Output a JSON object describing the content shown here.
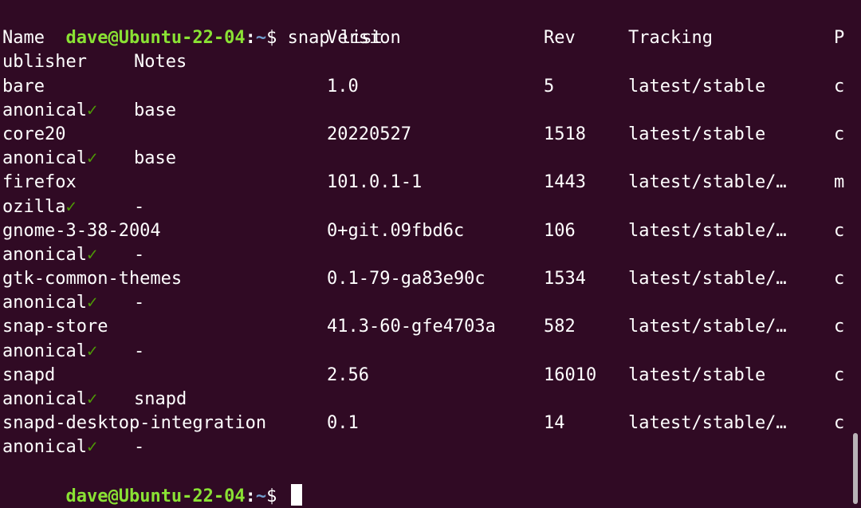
{
  "prompt": {
    "user_host": "dave@Ubuntu-22-04",
    "separator": ":",
    "path": "~",
    "symbol": "$ "
  },
  "command": "snap list",
  "headers": {
    "name": "Name",
    "version": "Version",
    "rev": "Rev",
    "tracking": "Tracking",
    "publisher_head": "P",
    "publisher_tail": "ublisher",
    "notes": "Notes"
  },
  "rows": [
    {
      "name": "bare",
      "version": "1.0",
      "rev": "5",
      "tracking": "latest/stable",
      "publisher_head": "c",
      "publisher_tail": "anonical",
      "check": "✓",
      "notes": "base"
    },
    {
      "name": "core20",
      "version": "20220527",
      "rev": "1518",
      "tracking": "latest/stable",
      "publisher_head": "c",
      "publisher_tail": "anonical",
      "check": "✓",
      "notes": "base"
    },
    {
      "name": "firefox",
      "version": "101.0.1-1",
      "rev": "1443",
      "tracking": "latest/stable/…",
      "publisher_head": "m",
      "publisher_tail": "ozilla",
      "check": "✓",
      "notes": "-"
    },
    {
      "name": "gnome-3-38-2004",
      "version": "0+git.09fbd6c",
      "rev": "106",
      "tracking": "latest/stable/…",
      "publisher_head": "c",
      "publisher_tail": "anonical",
      "check": "✓",
      "notes": "-"
    },
    {
      "name": "gtk-common-themes",
      "version": "0.1-79-ga83e90c",
      "rev": "1534",
      "tracking": "latest/stable/…",
      "publisher_head": "c",
      "publisher_tail": "anonical",
      "check": "✓",
      "notes": "-"
    },
    {
      "name": "snap-store",
      "version": "41.3-60-gfe4703a",
      "rev": "582",
      "tracking": "latest/stable/…",
      "publisher_head": "c",
      "publisher_tail": "anonical",
      "check": "✓",
      "notes": "-"
    },
    {
      "name": "snapd",
      "version": "2.56",
      "rev": "16010",
      "tracking": "latest/stable",
      "publisher_head": "c",
      "publisher_tail": "anonical",
      "check": "✓",
      "notes": "snapd"
    },
    {
      "name": "snapd-desktop-integration",
      "version": "0.1",
      "rev": "14",
      "tracking": "latest/stable/…",
      "publisher_head": "c",
      "publisher_tail": "anonical",
      "check": "✓",
      "notes": "-"
    }
  ],
  "colors": {
    "background": "#300a24",
    "prompt_user": "#8ae234",
    "prompt_path": "#729fcf",
    "check": "#4e9a06",
    "text": "#ffffff"
  }
}
